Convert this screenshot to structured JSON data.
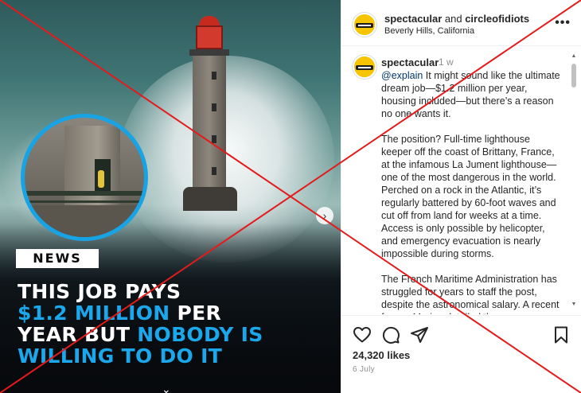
{
  "media": {
    "news_tag": "NEWS",
    "headline": {
      "line1": "THIS  JOB PAYS",
      "line2_blue": "$1.2 MILLION",
      "line2_white": " PER",
      "line3_white": "YEAR BUT ",
      "line3_blue": "NOBODY IS",
      "line4_blue": "WILLING TO DO IT"
    },
    "accent_color": "#1aa7ec"
  },
  "post": {
    "header": {
      "user1": "spectacular",
      "joiner": " and ",
      "user2": "circleofidiots",
      "location": "Beverly Hills, California",
      "more_icon": "more-horizontal-icon"
    },
    "caption": {
      "username": "spectacular",
      "time": "1 w",
      "mention": "@explain",
      "para1_rest": " It might sound like the ultimate dream job—$1.2 million per year, housing included—but there’s a reason no one wants it.",
      "para2": "The position? Full-time lighthouse keeper off the coast of Brittany, France, at the infamous La Jument lighthouse—one of the most dangerous in the world. Perched on a rock in the Atlantic, it’s regularly battered by 60-foot waves and cut off from land for weeks at a time. Access is only possible by helicopter, and emergency evacuation is nearly impossible during storms.",
      "para3": "The French Maritime Administration has struggled for years to staff the post, despite the astronomical salary. A recent former Marine detailed the"
    },
    "likes": "24,320 likes",
    "date": "6 July"
  },
  "overlay_color": "#e31b1b"
}
